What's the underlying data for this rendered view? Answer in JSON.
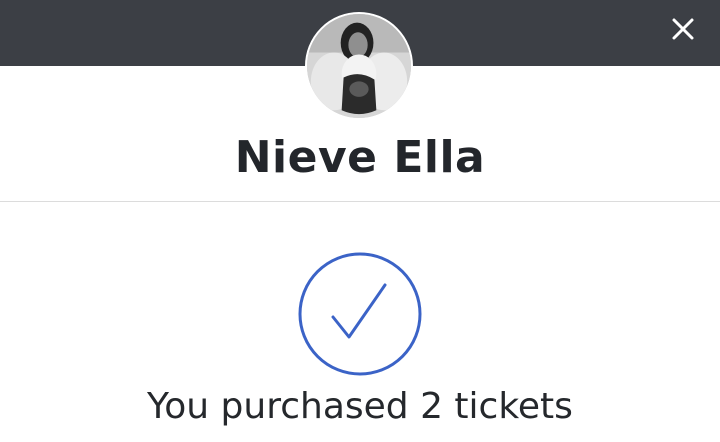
{
  "modal": {
    "artist_name": "Nieve Ella",
    "confirmation_message": "You purchased 2 tickets"
  },
  "icons": {
    "close": "close-icon",
    "success": "checkmark-circle-icon"
  },
  "colors": {
    "header_bg": "#3c3f45",
    "accent": "#3b63c7",
    "text": "#23262b"
  }
}
